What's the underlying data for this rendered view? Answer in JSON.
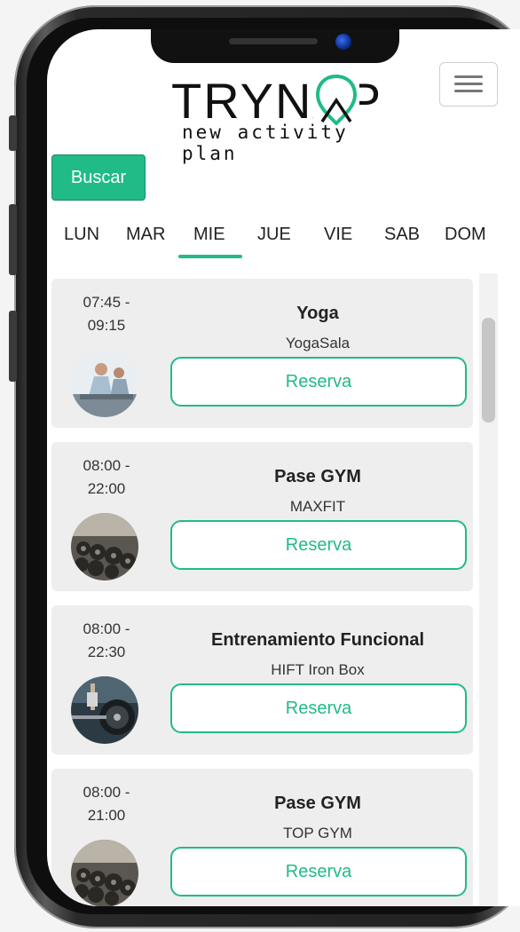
{
  "header": {
    "logo_main": "TRYNAP",
    "logo_sub": "new activity plan",
    "menu_icon": "hamburger-icon"
  },
  "search": {
    "label": "Buscar"
  },
  "days": [
    "LUN",
    "MAR",
    "MIE",
    "JUE",
    "VIE",
    "SAB",
    "DOM"
  ],
  "selected_day": "MIE",
  "colors": {
    "accent": "#20bb87",
    "card_bg": "#eeeeee"
  },
  "activities": [
    {
      "time_start": "07:45 -",
      "time_end": "09:15",
      "title": "Yoga",
      "place": "YogaSala",
      "action": "Reserva",
      "image": "yoga-photo"
    },
    {
      "time_start": "08:00 -",
      "time_end": "22:00",
      "title": "Pase GYM",
      "place": "MAXFIT",
      "action": "Reserva",
      "image": "gym-photo"
    },
    {
      "time_start": "08:00 -",
      "time_end": "22:30",
      "title": "Entrenamiento Funcional",
      "place": "HIFT Iron Box",
      "action": "Reserva",
      "image": "barbell-photo"
    },
    {
      "time_start": "08:00 -",
      "time_end": "21:00",
      "title": "Pase GYM",
      "place": "TOP GYM",
      "action": "Reserva",
      "image": "gym-photo"
    }
  ]
}
